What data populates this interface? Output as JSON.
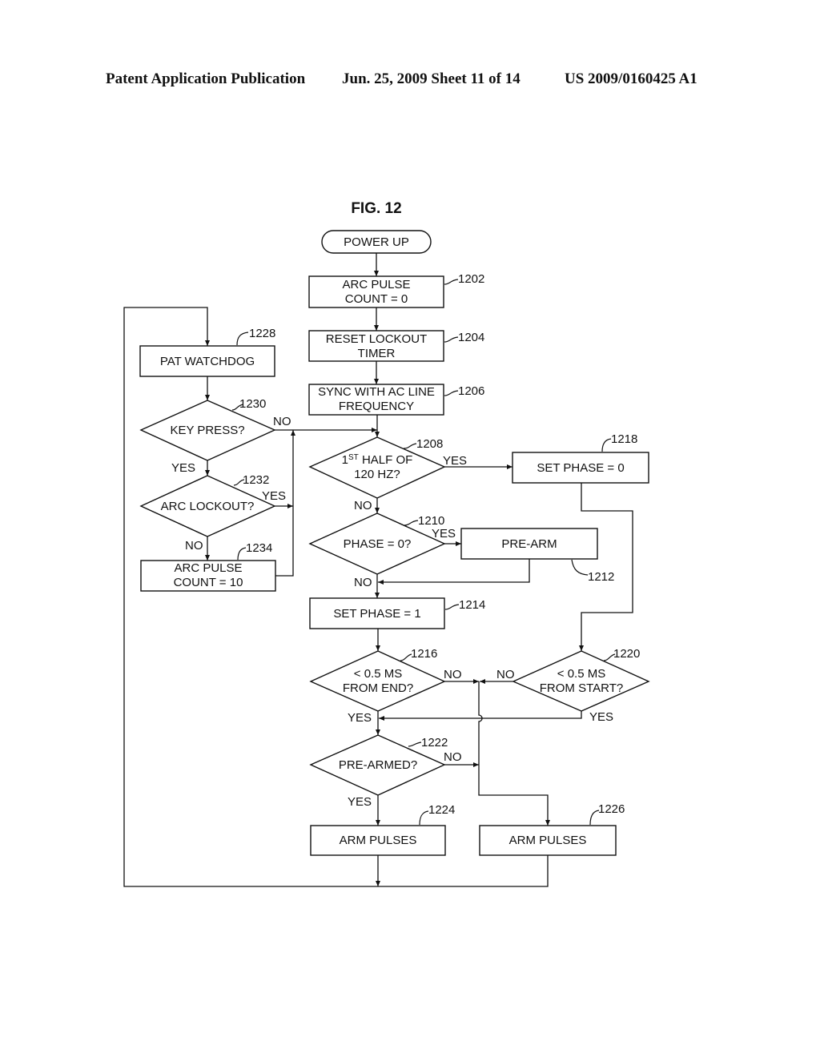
{
  "header": {
    "left": "Patent Application Publication",
    "middle": "Jun. 25, 2009  Sheet 11 of 14",
    "right": "US 2009/0160425 A1"
  },
  "figure": {
    "title": "FIG. 12",
    "start": {
      "label": "POWER UP"
    },
    "nodes": {
      "n1202": {
        "ref": "1202",
        "type": "process",
        "lines": [
          "ARC PULSE",
          "COUNT = 0"
        ]
      },
      "n1204": {
        "ref": "1204",
        "type": "process",
        "lines": [
          "RESET LOCKOUT",
          "TIMER"
        ]
      },
      "n1206": {
        "ref": "1206",
        "type": "process",
        "lines": [
          "SYNC WITH AC LINE",
          "FREQUENCY"
        ]
      },
      "n1208": {
        "ref": "1208",
        "type": "decision",
        "line1_pre": "1",
        "line1_sup": "ST",
        "line1_post": " HALF OF",
        "line2": "120 HZ?"
      },
      "n1210": {
        "ref": "1210",
        "type": "decision",
        "lines": [
          "PHASE = 0?"
        ]
      },
      "n1212": {
        "ref": "1212",
        "type": "process",
        "lines": [
          "PRE-ARM"
        ]
      },
      "n1214": {
        "ref": "1214",
        "type": "process",
        "lines": [
          "SET PHASE = 1"
        ]
      },
      "n1216": {
        "ref": "1216",
        "type": "decision",
        "lines": [
          "< 0.5 MS",
          "FROM END?"
        ]
      },
      "n1218": {
        "ref": "1218",
        "type": "process",
        "lines": [
          "SET PHASE = 0"
        ]
      },
      "n1220": {
        "ref": "1220",
        "type": "decision",
        "lines": [
          "< 0.5 MS",
          "FROM START?"
        ]
      },
      "n1222": {
        "ref": "1222",
        "type": "decision",
        "lines": [
          "PRE-ARMED?"
        ]
      },
      "n1224": {
        "ref": "1224",
        "type": "process",
        "lines": [
          "ARM PULSES"
        ]
      },
      "n1226": {
        "ref": "1226",
        "type": "process",
        "lines": [
          "ARM PULSES"
        ]
      },
      "n1228": {
        "ref": "1228",
        "type": "process",
        "lines": [
          "PAT WATCHDOG"
        ]
      },
      "n1230": {
        "ref": "1230",
        "type": "decision",
        "lines": [
          "KEY PRESS?"
        ]
      },
      "n1232": {
        "ref": "1232",
        "type": "decision",
        "lines": [
          "ARC LOCKOUT?"
        ]
      },
      "n1234": {
        "ref": "1234",
        "type": "process",
        "lines": [
          "ARC PULSE",
          "COUNT = 10"
        ]
      }
    },
    "edge_labels": {
      "e1230_no": "NO",
      "e1230_yes": "YES",
      "e1232_yes": "YES",
      "e1232_no": "NO",
      "e1208_yes": "YES",
      "e1208_no": "NO",
      "e1210_yes": "YES",
      "e1210_no": "NO",
      "e1216_no": "NO",
      "e1216_yes": "YES",
      "e1220_no": "NO",
      "e1220_yes": "YES",
      "e1222_no": "NO",
      "e1222_yes": "YES"
    }
  }
}
